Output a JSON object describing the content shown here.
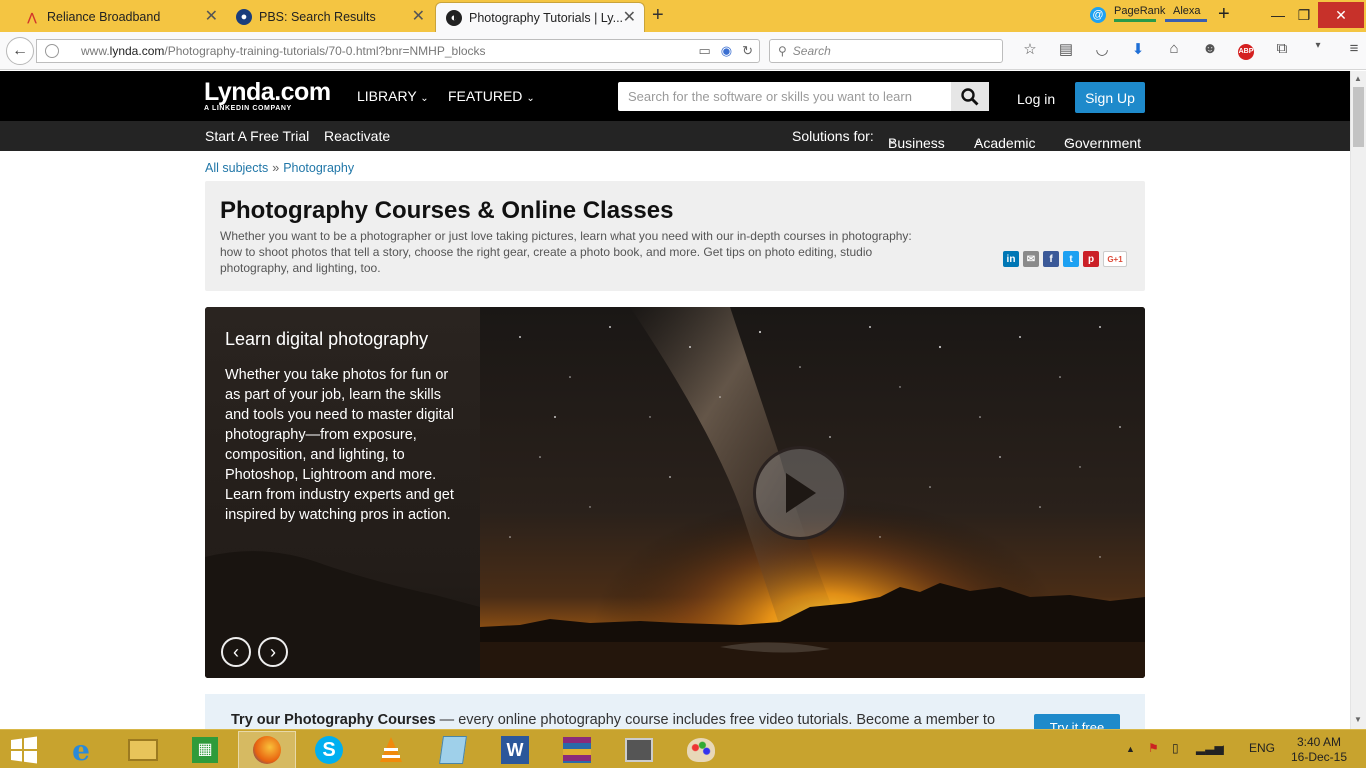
{
  "browser": {
    "tabs": [
      {
        "label": "Reliance Broadband",
        "active": false
      },
      {
        "label": "PBS: Search Results",
        "active": false
      },
      {
        "label": "Photography Tutorials | Ly...",
        "active": true
      }
    ],
    "toolbar_labels": {
      "pagerank": "PageRank",
      "alexa": "Alexa"
    },
    "url_prefix": "www.",
    "url_domain": "lynda.com",
    "url_path": "/Photography-training-tutorials/70-0.html?bnr=NMHP_blocks",
    "search_placeholder": "Search",
    "adblock_label": "ABP"
  },
  "site": {
    "logo_main": "Lynda.com",
    "logo_sub": "A LINKEDIN COMPANY",
    "nav": {
      "library": "LIBRARY",
      "featured": "FEATURED"
    },
    "search_placeholder": "Search for the software or skills you want to learn",
    "login": "Log in",
    "signup": "Sign Up",
    "subnav": {
      "trial": "Start A Free Trial",
      "reactivate": "Reactivate",
      "solutions_for": "Solutions for:",
      "business": "Business",
      "academic": "Academic",
      "government": "Government"
    }
  },
  "breadcrumb": {
    "all": "All subjects",
    "sep": "»",
    "current": "Photography"
  },
  "intro": {
    "title": "Photography Courses & Online Classes",
    "description": "Whether you want to be a photographer or just love taking pictures, learn what you need with our in-depth courses in photography: how to shoot photos that tell a story, choose the right gear, create a photo book, and more. Get tips on photo editing, studio photography, and lighting, too.",
    "share_gplus": "G+1"
  },
  "hero": {
    "title": "Learn digital photography",
    "body": "Whether you take photos for fun or as part of your job, learn the skills and tools you need to master digital photography—from exposure, composition, and lighting, to Photoshop, Lightroom and more. Learn from industry experts and get inspired by watching pros in action.",
    "prev": "‹",
    "next": "›"
  },
  "promo": {
    "bold": "Try our Photography Courses",
    "rest": " — every online photography course includes free video tutorials. Become a member to",
    "button": "Try it free"
  },
  "taskbar": {
    "lang": "ENG",
    "time": "3:40 AM",
    "date": "16-Dec-15"
  },
  "colors": {
    "firefox_tabbar": "#f4c542",
    "site_header": "#000000",
    "subnav": "#242424",
    "accent_blue": "#1e8acb",
    "link_blue": "#2177a8",
    "taskbar": "#c8a32e"
  }
}
